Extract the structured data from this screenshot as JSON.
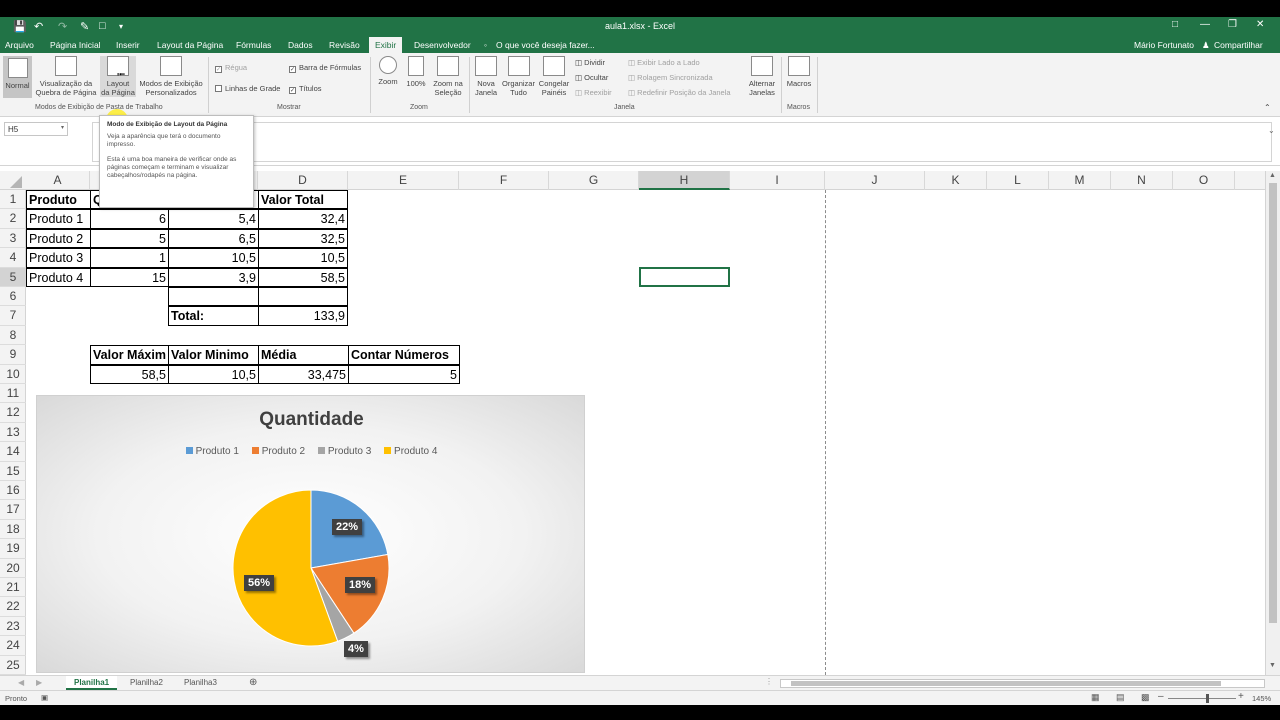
{
  "window": {
    "title": "aula1.xlsx - Excel"
  },
  "tabs": [
    "Arquivo",
    "Página Inicial",
    "Inserir",
    "Layout da Página",
    "Fórmulas",
    "Dados",
    "Revisão",
    "Exibir",
    "Desenvolvedor"
  ],
  "search_placeholder": "O que você deseja fazer...",
  "user": "Mário Fortunato",
  "share": "Compartilhar",
  "ribbon": {
    "views": {
      "normal": "Normal",
      "page_break_1": "Visualização da",
      "page_break_2": "Quebra de Página",
      "layout_1": "Layout",
      "layout_2": "da Página",
      "custom_1": "Modos de Exibição",
      "custom_2": "Personalizados",
      "group": "Modos de Exibição de Pasta de Trabalho"
    },
    "show": {
      "ruler": "Régua",
      "formula_bar": "Barra de Fórmulas",
      "gridlines": "Linhas de Grade",
      "headings": "Títulos",
      "group": "Mostrar"
    },
    "zoom": {
      "zoom": "Zoom",
      "hundred": "100%",
      "sel_1": "Zoom na",
      "sel_2": "Seleção",
      "group": "Zoom"
    },
    "window": {
      "new_1": "Nova",
      "new_2": "Janela",
      "arrange_1": "Organizar",
      "arrange_2": "Tudo",
      "freeze_1": "Congelar",
      "freeze_2": "Painéis",
      "split": "Dividir",
      "hide": "Ocultar",
      "unhide": "Reexibir",
      "side": "Exibir Lado a Lado",
      "sync": "Rolagem Sincronizada",
      "reset": "Redefinir Posição da Janela",
      "switch_1": "Alternar",
      "switch_2": "Janelas",
      "group": "Janela"
    },
    "macros": {
      "label": "Macros",
      "group": "Macros"
    }
  },
  "tooltip": {
    "title": "Modo de Exibição de Layout da Página",
    "p1": "Veja a aparência que terá o documento impresso.",
    "p2": "Esta é uma boa maneira de verificar onde as páginas começam e terminam e visualizar cabeçalhos/rodapés na página."
  },
  "namebox": "H5",
  "columns": [
    "A",
    "B",
    "C",
    "D",
    "E",
    "F",
    "G",
    "H",
    "I",
    "J",
    "K",
    "L",
    "M",
    "N",
    "O"
  ],
  "rows": [
    "1",
    "2",
    "3",
    "4",
    "5",
    "6",
    "7",
    "8",
    "9",
    "10",
    "11",
    "12",
    "13",
    "14",
    "15",
    "16",
    "17",
    "18",
    "19",
    "20",
    "21",
    "22",
    "23",
    "24",
    "25"
  ],
  "cells": {
    "a1": "Produto",
    "b1": "Q",
    "d1": "Valor Total",
    "a2": "Produto 1",
    "b2": "6",
    "c2": "5,4",
    "d2": "32,4",
    "a3": "Produto 2",
    "b3": "5",
    "c3": "6,5",
    "d3": "32,5",
    "a4": "Produto 3",
    "b4": "1",
    "c4": "10,5",
    "d4": "10,5",
    "a5": "Produto 4",
    "b5": "15",
    "c5": "3,9",
    "d5": "58,5",
    "c7": "Total:",
    "d7": "133,9",
    "b9": "Valor Máxim",
    "c9": "Valor Minimo",
    "d9": "Média",
    "e9": "Contar Números",
    "b10": "58,5",
    "c10": "10,5",
    "d10": "33,475",
    "e10": "5"
  },
  "chart_data": {
    "type": "pie",
    "title": "Quantidade",
    "categories": [
      "Produto 1",
      "Produto 2",
      "Produto 3",
      "Produto 4"
    ],
    "values": [
      6,
      5,
      1,
      15
    ],
    "labels": [
      "22%",
      "18%",
      "4%",
      "56%"
    ],
    "colors": [
      "#5b9bd5",
      "#ed7d31",
      "#a5a5a5",
      "#ffc000"
    ],
    "legend": "top"
  },
  "sheets": [
    "Planilha1",
    "Planilha2",
    "Planilha3"
  ],
  "status": {
    "ready": "Pronto",
    "zoom": "145%"
  }
}
